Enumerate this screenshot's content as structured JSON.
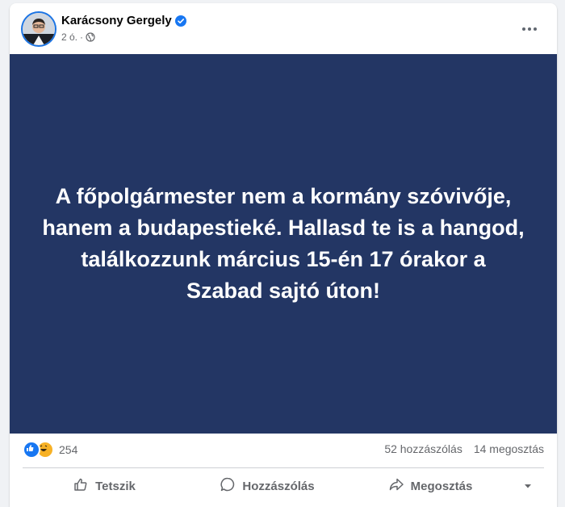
{
  "post": {
    "author": "Karácsony Gergely",
    "time": "2 ó.",
    "separator": "·",
    "image_text": "A főpolgármester nem a kormány szóvivője, hanem a budapestieké. Hallasd te is a hangod, találkozzunk március 15-én 17 órakor a Szabad sajtó úton!",
    "image_background": "#233664"
  },
  "stats": {
    "reaction_count": "254",
    "reactions": [
      "like-icon",
      "haha-icon"
    ],
    "comments": "52 hozzászólás",
    "shares": "14 megosztás"
  },
  "actions": {
    "like": "Tetszik",
    "comment": "Hozzászólás",
    "share": "Megosztás"
  },
  "colors": {
    "accent": "#1877f2",
    "secondary_text": "#65676b"
  }
}
